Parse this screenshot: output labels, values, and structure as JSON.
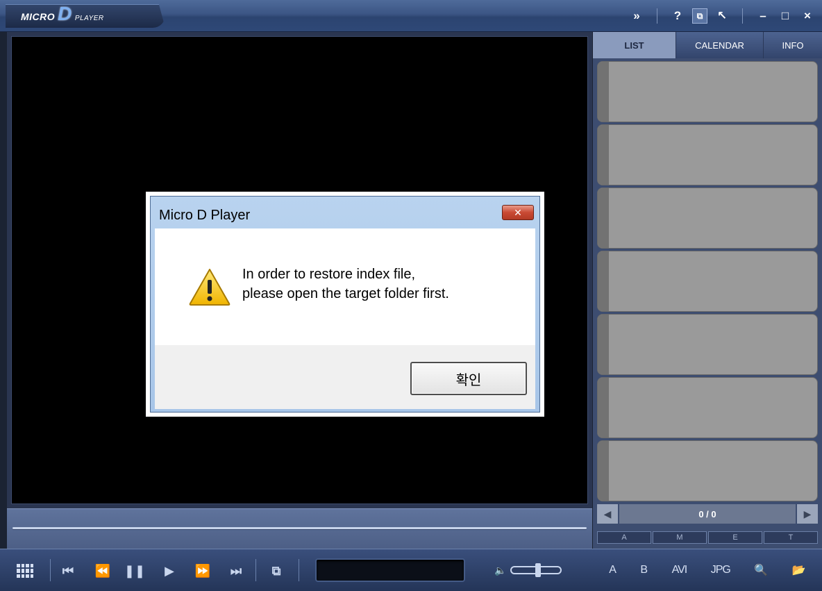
{
  "app": {
    "logo_prefix": "MICRO",
    "logo_letter": "D",
    "logo_suffix": "PLAYER"
  },
  "titlebar": {
    "expand_icon": "»",
    "help_icon": "?",
    "window_icon": "⧉",
    "tool_icon": "↖",
    "minimize_icon": "–",
    "maximize_icon": "□",
    "close_icon": "×"
  },
  "controls": {
    "icons": [
      "grid-icon",
      "skip-start-icon",
      "rewind-icon",
      "pause-icon",
      "play-icon",
      "fast-forward-icon",
      "skip-end-icon",
      "copy-frame-icon"
    ],
    "glyphs": {
      "first": "⏮",
      "rewind": "⏪",
      "pause": "❚❚",
      "play": "▶",
      "forward": "⏩",
      "last": "⏭",
      "copy": "⧉"
    },
    "speaker": "🔈"
  },
  "panel": {
    "tabs": [
      {
        "label": "LIST",
        "active": true
      },
      {
        "label": "CALENDAR",
        "active": false
      },
      {
        "label": "INFO",
        "active": false
      }
    ],
    "pager": {
      "prev": "◀",
      "count": "0 / 0",
      "next": "▶"
    },
    "filters": [
      "A",
      "M",
      "E",
      "T"
    ],
    "tools": [
      "A",
      "B",
      "AVI",
      "JPG",
      "🔍",
      "📂"
    ]
  },
  "dialog": {
    "title": "Micro D Player",
    "close": "✕",
    "message_line1": "In order to restore index file,",
    "message_line2": "please open the target folder first.",
    "ok_label": "확인"
  },
  "colors": {
    "accent": "#3b5584",
    "video_bg": "#000000",
    "list_item": "#9a9a9a",
    "dialog_frame": "#b9d3ef"
  }
}
